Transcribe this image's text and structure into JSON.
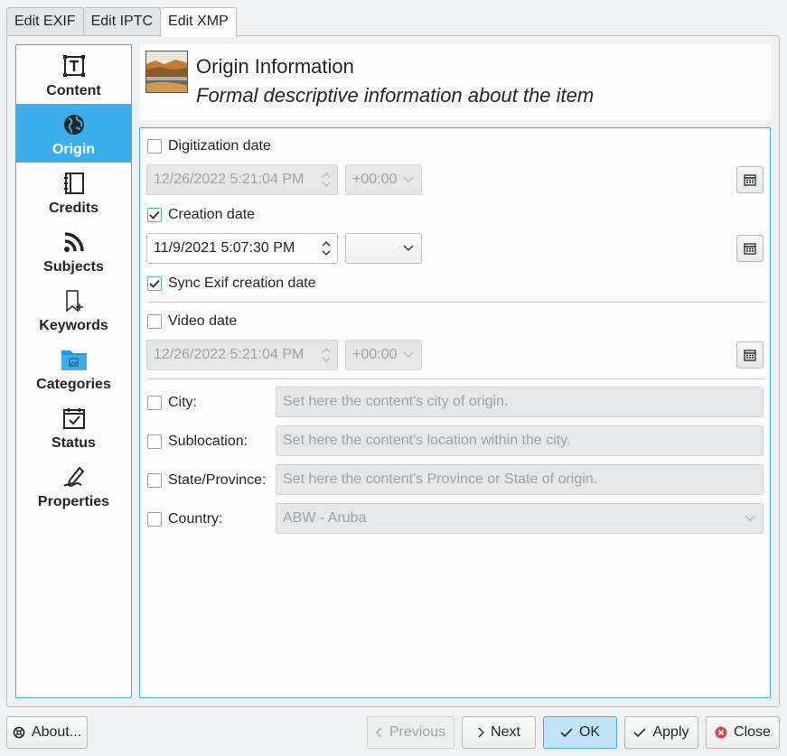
{
  "tabs": [
    "Edit EXIF",
    "Edit IPTC",
    "Edit XMP"
  ],
  "sidebar": {
    "items": [
      {
        "label": "Content",
        "icon": "text-frame-icon"
      },
      {
        "label": "Origin",
        "icon": "globe-icon"
      },
      {
        "label": "Credits",
        "icon": "notebook-icon"
      },
      {
        "label": "Subjects",
        "icon": "rss-icon"
      },
      {
        "label": "Keywords",
        "icon": "bookmark-add-icon"
      },
      {
        "label": "Categories",
        "icon": "folder-image-icon"
      },
      {
        "label": "Status",
        "icon": "calendar-check-icon"
      },
      {
        "label": "Properties",
        "icon": "pen-signature-icon"
      }
    ],
    "active_index": 1
  },
  "header": {
    "title": "Origin Information",
    "subtitle": "Formal descriptive information about the item"
  },
  "form": {
    "digitization": {
      "label": "Digitization date",
      "checked": false,
      "datetime": "12/26/2022 5:21:04 PM",
      "tz": "+00:00"
    },
    "creation": {
      "label": "Creation date",
      "checked": true,
      "datetime": "11/9/2021 5:07:30 PM",
      "tz": ""
    },
    "sync_exif": {
      "label": "Sync Exif creation date",
      "checked": true
    },
    "video": {
      "label": "Video date",
      "checked": false,
      "datetime": "12/26/2022 5:21:04 PM",
      "tz": "+00:00"
    },
    "city": {
      "label": "City:",
      "placeholder": "Set here the content's city of origin."
    },
    "sublocation": {
      "label": "Sublocation:",
      "placeholder": "Set here the content's location within the city."
    },
    "state": {
      "label": "State/Province:",
      "placeholder": "Set here the content's Province or State of origin."
    },
    "country": {
      "label": "Country:",
      "value": "ABW - Aruba"
    }
  },
  "buttons": {
    "about": "About...",
    "previous": "Previous",
    "next": "Next",
    "ok": "OK",
    "apply": "Apply",
    "close": "Close"
  },
  "colors": {
    "accent": "#3daee9",
    "close_icon": "#da4453"
  }
}
